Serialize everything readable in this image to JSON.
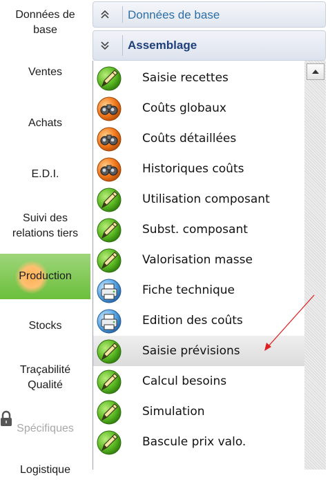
{
  "nav": {
    "items": [
      {
        "label": "Données de\nbase"
      },
      {
        "label": "Ventes"
      },
      {
        "label": "Achats"
      },
      {
        "label": "E.D.I."
      },
      {
        "label": "Suivi des\nrelations tiers"
      },
      {
        "label": "Production",
        "active": true
      },
      {
        "label": "Stocks"
      },
      {
        "label": "Traçabilité\nQualité"
      },
      {
        "label": "Spécifiques",
        "disabled": true
      },
      {
        "label": "Logistique"
      }
    ]
  },
  "panel": {
    "section1": {
      "title": "Données de base",
      "chevron": "chevrons-up-icon",
      "color": "#2b6fa6"
    },
    "section2": {
      "title": "Assemblage",
      "chevron": "chevrons-down-icon",
      "color": "#1e3f7a"
    }
  },
  "list": {
    "items": [
      {
        "label": "Saisie recettes",
        "icon": "pen-icon"
      },
      {
        "label": "Coûts globaux",
        "icon": "binoculars-icon"
      },
      {
        "label": "Coûts détaillées",
        "icon": "binoculars-icon"
      },
      {
        "label": "Historiques coûts",
        "icon": "binoculars-icon"
      },
      {
        "label": "Utilisation composant",
        "icon": "pen-icon"
      },
      {
        "label": "Subst. composant",
        "icon": "pen-icon"
      },
      {
        "label": "Valorisation masse",
        "icon": "pen-icon"
      },
      {
        "label": "Fiche technique",
        "icon": "printer-icon"
      },
      {
        "label": "Edition des coûts",
        "icon": "printer-icon"
      },
      {
        "label": "Saisie prévisions",
        "icon": "pen-icon",
        "selected": true
      },
      {
        "label": "Calcul besoins",
        "icon": "pen-icon"
      },
      {
        "label": "Simulation",
        "icon": "pen-icon"
      },
      {
        "label": "Bascule prix valo.",
        "icon": "pen-icon"
      }
    ]
  },
  "annotation": {
    "type": "red-arrow",
    "color": "#e02020",
    "target": "Saisie prévisions"
  },
  "colors": {
    "active_nav": "#7cc84a",
    "header_text": "#2b6fa6"
  }
}
